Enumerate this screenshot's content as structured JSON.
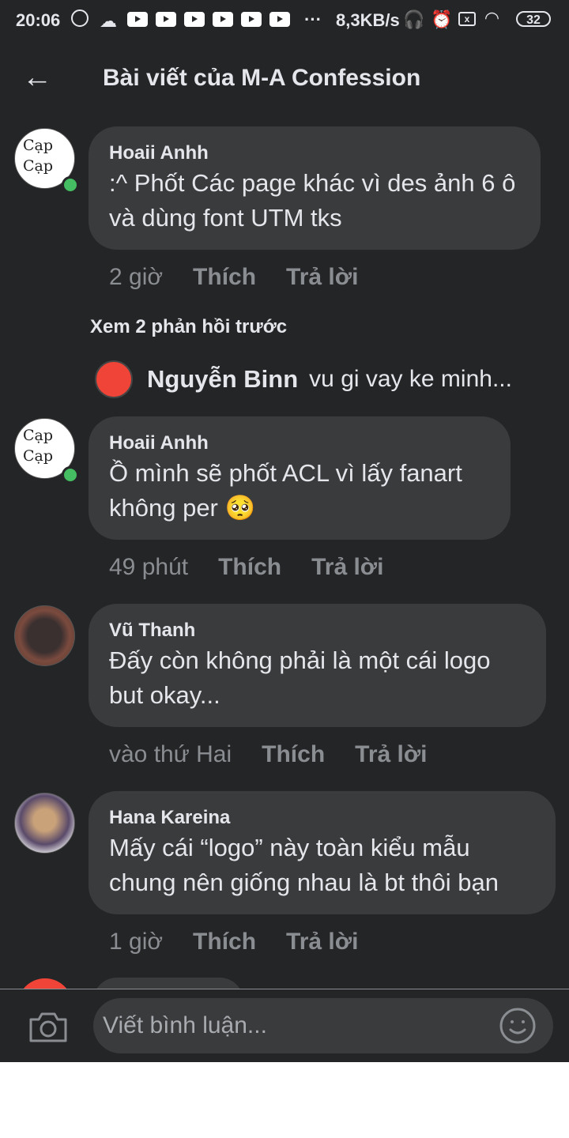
{
  "status_bar": {
    "time": "20:06",
    "network_speed": "8,3KB/s",
    "battery": "32",
    "dots": "···"
  },
  "header": {
    "back_icon": "arrow-left",
    "title": "Bài viết của M-A Confession"
  },
  "comments": [
    {
      "avatar_text": "Cạp Cạp",
      "name": "Hoaii Anhh",
      "text": ":^ Phốt Các page khác vì des ảnh 6 ô và dùng font UTM tks",
      "time": "2 giờ",
      "like": "Thích",
      "reply": "Trả lời",
      "online": true
    },
    {
      "avatar_text": "Cạp Cạp",
      "name": "Hoaii Anhh",
      "text": "Ồ mình sẽ phốt ACL vì lấy fanart không per 🥺",
      "time": "49 phút",
      "like": "Thích",
      "reply": "Trả lời",
      "online": true
    },
    {
      "name": "Vũ Thanh",
      "text": "Đấy còn không phải là một cái logo but okay...",
      "time": "vào thứ Hai",
      "like": "Thích",
      "reply": "Trả lời"
    },
    {
      "name": "Hana Kareina",
      "text": "Mấy cái “logo” này toàn kiểu mẫu chung nên giống nhau là bt thôi bạn",
      "time": "1 giờ",
      "like": "Thích",
      "reply": "Trả lời"
    }
  ],
  "view_more_replies": "Xem 2 phản hồi trước",
  "reply_preview": {
    "name": "Nguyễn Binn",
    "text": "vu gi vay ke minh..."
  },
  "composer": {
    "placeholder": "Viết bình luận...",
    "camera_icon": "camera",
    "emoji_icon": "smiley"
  }
}
